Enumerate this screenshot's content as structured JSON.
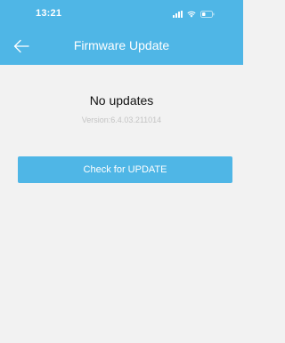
{
  "status_bar": {
    "time": "13:21",
    "icons": [
      "signal-icon",
      "wifi-icon",
      "battery-icon"
    ]
  },
  "header": {
    "back_icon": "back-arrow-icon",
    "title": "Firmware Update"
  },
  "main": {
    "status_title": "No updates",
    "version": "Version:6.4.03.211014",
    "check_button_label": "Check for UPDATE"
  },
  "colors": {
    "accent": "#4fb6e6",
    "background": "#f2f2f2",
    "muted_text": "#c4c4c4"
  }
}
